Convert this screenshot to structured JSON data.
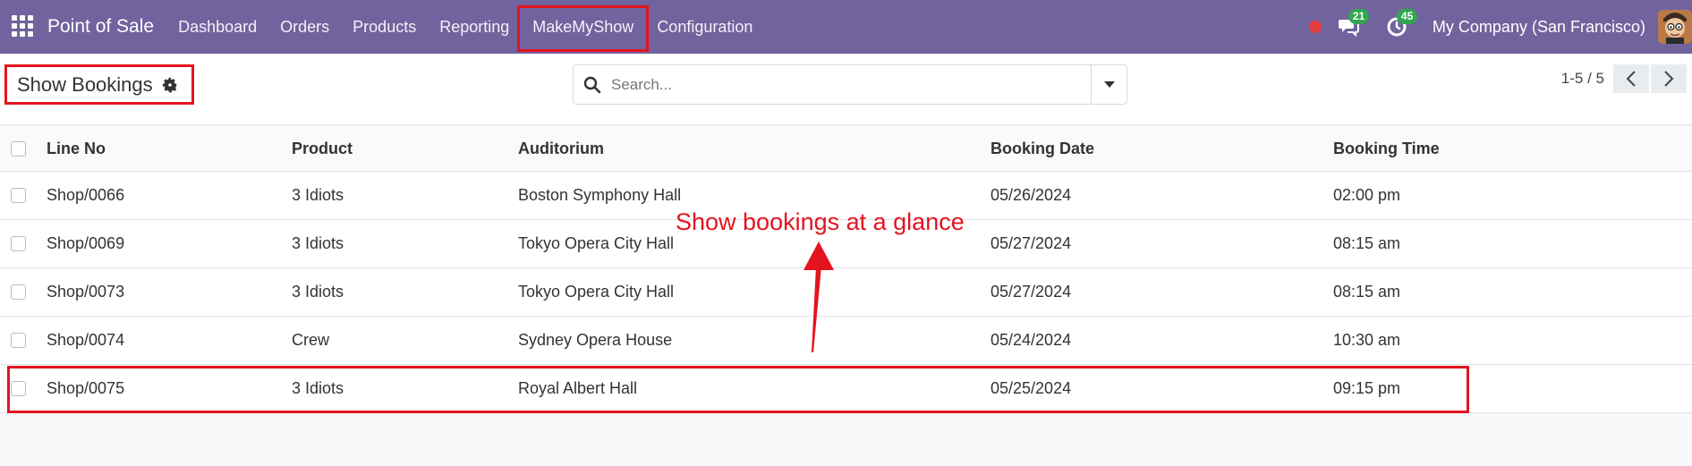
{
  "navbar": {
    "brand": "Point of Sale",
    "menu": [
      "Dashboard",
      "Orders",
      "Products",
      "Reporting",
      "MakeMyShow",
      "Configuration"
    ],
    "messages_count": "21",
    "activities_count": "45",
    "company": "My Company (San Francisco)",
    "accent_color": "#71639e"
  },
  "control": {
    "title": "Show Bookings",
    "search_placeholder": "Search...",
    "pager": "1-5 / 5"
  },
  "table": {
    "columns": [
      "Line No",
      "Product",
      "Auditorium",
      "Booking Date",
      "Booking Time"
    ],
    "rows": [
      [
        "Shop/0066",
        "3 Idiots",
        "Boston Symphony Hall",
        "05/26/2024",
        "02:00 pm"
      ],
      [
        "Shop/0069",
        "3 Idiots",
        "Tokyo Opera City Hall",
        "05/27/2024",
        "08:15 am"
      ],
      [
        "Shop/0073",
        "3 Idiots",
        "Tokyo Opera City Hall",
        "05/27/2024",
        "08:15 am"
      ],
      [
        "Shop/0074",
        "Crew",
        "Sydney Opera House",
        "05/24/2024",
        "10:30 am"
      ],
      [
        "Shop/0075",
        "3 Idiots",
        "Royal Albert Hall",
        "05/25/2024",
        "09:15 pm"
      ]
    ]
  },
  "annotation": {
    "text": "Show bookings at a glance",
    "color": "#e4141f"
  }
}
